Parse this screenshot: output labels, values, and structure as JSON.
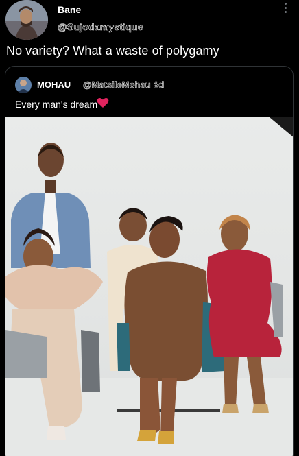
{
  "tweet": {
    "author_name": "Bane",
    "author_handle": "@Sujodamystique",
    "text": "No variety? What a waste of polygamy"
  },
  "quoted": {
    "author_name": "MOHAU",
    "author_handle": "@MatsileMohau",
    "separator": "·",
    "time": "2d",
    "text": "Every man's dream"
  },
  "icons": {
    "more": "more-vertical-icon",
    "heart": "red-heart-icon"
  },
  "colors": {
    "background": "#000000",
    "text": "#ffffff",
    "border": "#2f3336",
    "heart": "#e0245e"
  }
}
